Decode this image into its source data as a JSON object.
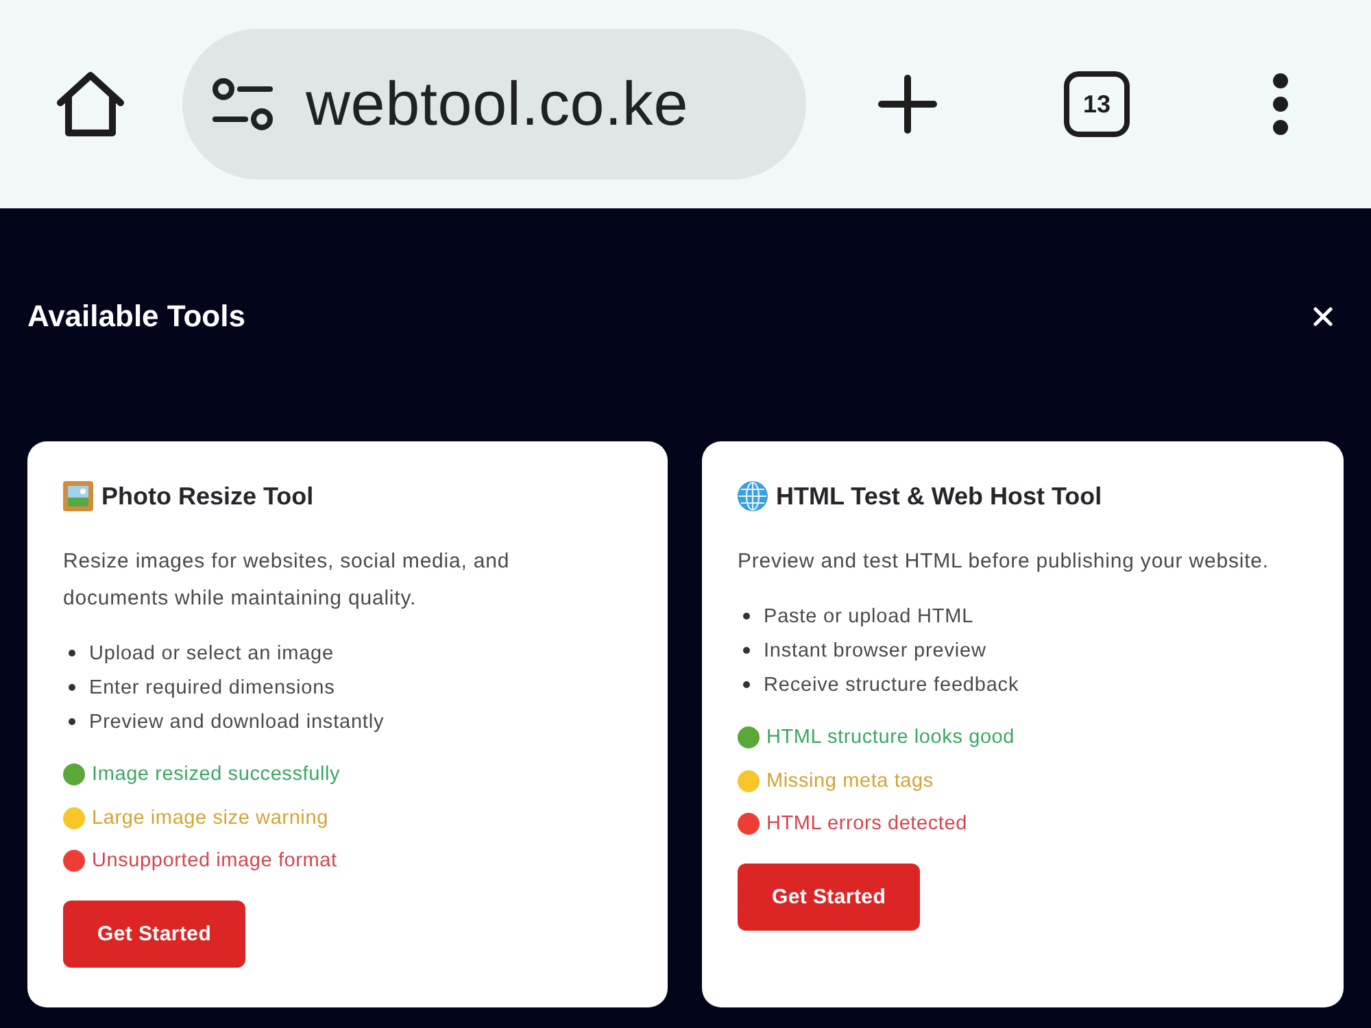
{
  "browser": {
    "url": "webtool.co.ke",
    "tab_count": "13"
  },
  "panel": {
    "title": "Available Tools"
  },
  "tools": [
    {
      "title": "Photo Resize Tool",
      "description": "Resize images for websites, social media, and documents while maintaining quality.",
      "features": [
        "Upload or select an image",
        "Enter required dimensions",
        "Preview and download instantly"
      ],
      "statuses": [
        {
          "kind": "success",
          "color": "#5aa83a",
          "text": "Image resized successfully"
        },
        {
          "kind": "warning",
          "color": "#f8c52a",
          "text": "Large image size warning"
        },
        {
          "kind": "error",
          "color": "#ee3d35",
          "text": "Unsupported image format"
        }
      ],
      "button": "Get Started"
    },
    {
      "title": "HTML Test & Web Host Tool",
      "description": "Preview and test HTML before publishing your website.",
      "features": [
        "Paste or upload HTML",
        "Instant browser preview",
        "Receive structure feedback"
      ],
      "statuses": [
        {
          "kind": "success",
          "color": "#5aa83a",
          "text": "HTML structure looks good"
        },
        {
          "kind": "warning",
          "color": "#f8c52a",
          "text": "Missing meta tags"
        },
        {
          "kind": "error",
          "color": "#ee3d35",
          "text": "HTML errors detected"
        }
      ],
      "button": "Get Started"
    }
  ]
}
